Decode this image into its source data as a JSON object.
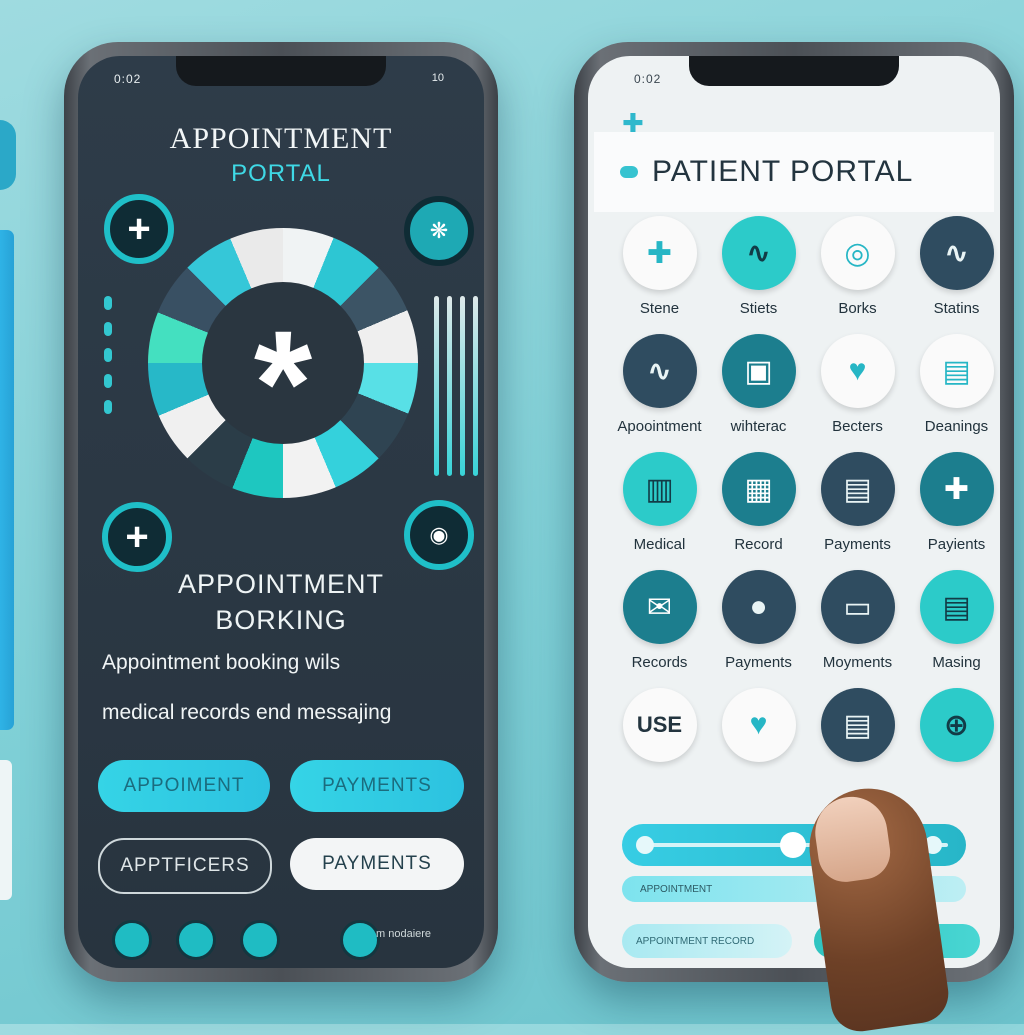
{
  "left_phone": {
    "status_time": "0:02",
    "status_right": "10",
    "title_line1": "APPOINTMENT",
    "title_line2": "PORTAL",
    "center_icon": "asterisk-icon",
    "booking_title_line1": "APPOINTMENT",
    "booking_title_line2": "BORKING",
    "booking_sub_line1": "Appointment booking  wils",
    "booking_sub_line2": "medical records end messajing",
    "buttons": {
      "appointment": "APPOIMENT",
      "payments_teal": "PAYMENTS",
      "appointments_outline": "APPTFICERS",
      "payments_white": "PAYMENTS"
    },
    "footer_text": "m nodaiere",
    "accent": "#1fbfc8"
  },
  "right_phone": {
    "status_time": "0:02",
    "title": "PATIENT PORTAL",
    "tiles": [
      {
        "label": "Stene",
        "icon": "plus-icon",
        "glyph": "✚",
        "style": "c-white"
      },
      {
        "label": "Stiets",
        "icon": "heartbeat-icon",
        "glyph": "∿",
        "style": "c-teal"
      },
      {
        "label": "Borks",
        "icon": "target-icon",
        "glyph": "◎",
        "style": "c-white"
      },
      {
        "label": "Statins",
        "icon": "heartbeat-icon",
        "glyph": "∿",
        "style": "c-navy"
      },
      {
        "label": "Apoointment",
        "icon": "heartbeat-icon",
        "glyph": "∿",
        "style": "c-navy"
      },
      {
        "label": "wihterac",
        "icon": "camera-icon",
        "glyph": "▣",
        "style": "c-dteal"
      },
      {
        "label": "Becters",
        "icon": "heart-icon",
        "glyph": "♥",
        "style": "c-white"
      },
      {
        "label": "Deanings",
        "icon": "clipboard-icon",
        "glyph": "▤",
        "style": "c-white"
      },
      {
        "label": "Medical",
        "icon": "medical-bag-icon",
        "glyph": "▥",
        "style": "c-teal"
      },
      {
        "label": "Record",
        "icon": "folder-icon",
        "glyph": "▦",
        "style": "c-dteal"
      },
      {
        "label": "Payments",
        "icon": "document-icon",
        "glyph": "▤",
        "style": "c-navy"
      },
      {
        "label": "Payients",
        "icon": "briefcase-icon",
        "glyph": "✚",
        "style": "c-dteal"
      },
      {
        "label": "Records",
        "icon": "envelope-icon",
        "glyph": "✉",
        "style": "c-dteal"
      },
      {
        "label": "Payments",
        "icon": "person-icon",
        "glyph": "●",
        "style": "c-navy"
      },
      {
        "label": "Moyments",
        "icon": "card-icon",
        "glyph": "▭",
        "style": "c-navy"
      },
      {
        "label": "Masing",
        "icon": "document-icon",
        "glyph": "▤",
        "style": "c-teal"
      },
      {
        "label": "",
        "icon": "use-icon",
        "glyph": "USE",
        "style": "c-white"
      },
      {
        "label": "",
        "icon": "heart-icon",
        "glyph": "♥",
        "style": "c-white"
      },
      {
        "label": "",
        "icon": "document-icon",
        "glyph": "▤",
        "style": "c-navy"
      },
      {
        "label": "",
        "icon": "compass-icon",
        "glyph": "⊕",
        "style": "c-teal"
      }
    ],
    "bar_text": "APPOINTMENT",
    "small_btn_left": "APPOINTMENT RECORD",
    "slider_value": 0.45
  }
}
